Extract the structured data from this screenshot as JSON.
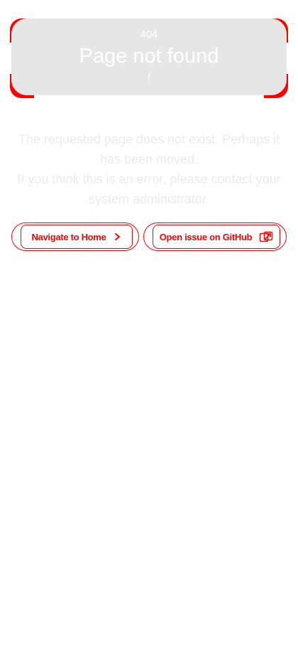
{
  "hero": {
    "code": "404",
    "title": "Page not found",
    "path": "/"
  },
  "message": {
    "line1": "The requested page does not exist. Perhaps it has been moved.",
    "line2": "If you think this is an error, please contact your system administrator."
  },
  "actions": {
    "home_label": "Navigate to Home",
    "home_icon": "chevron-right-icon",
    "issue_label": "Open issue on GitHub",
    "issue_icon": "external-link-icon"
  },
  "colors": {
    "accent": "#ff0000",
    "card": "#e6e6e6",
    "text_light": "#ebebeb"
  }
}
